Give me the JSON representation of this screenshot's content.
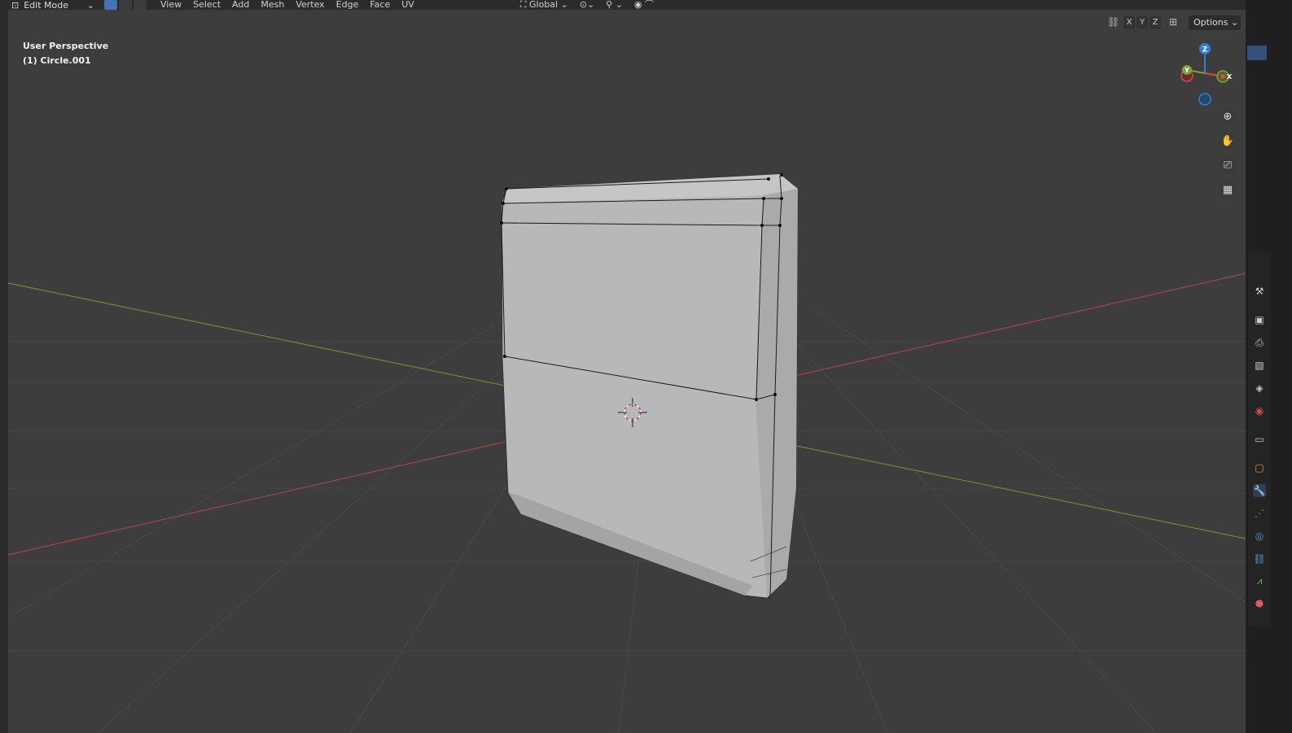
{
  "header": {
    "mode": "Edit Mode",
    "menus": [
      "View",
      "Select",
      "Add",
      "Mesh",
      "Vertex",
      "Edge",
      "Face",
      "UV"
    ],
    "orientation": "Global"
  },
  "viewport": {
    "perspective_label": "User Perspective",
    "object_label": "(1) Circle.001",
    "options_label": "Options",
    "axis_x": "X",
    "axis_y": "Y",
    "axis_z": "Z",
    "gizmo_z": "Z",
    "gizmo_y": "Y",
    "gizmo_x": "X"
  },
  "colors": {
    "accent": "#4772b3",
    "axis_x": "#d6474b",
    "axis_y": "#7ca23a",
    "axis_z": "#2f7fd6"
  },
  "icons": {
    "zoom": "zoom-icon",
    "pan": "hand-icon",
    "camera": "camera-icon",
    "grid": "grid-icon"
  }
}
